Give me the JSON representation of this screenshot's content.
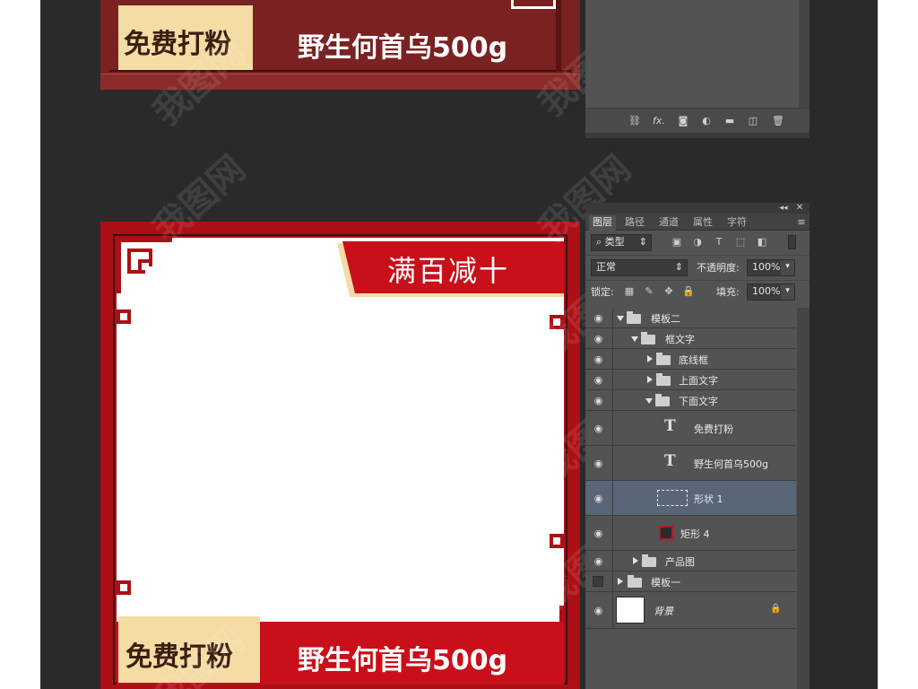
{
  "canvas": {
    "top_product": {
      "tag": "免费打粉",
      "title": "野生何首乌500g"
    },
    "bottom_product": {
      "banner": "满百减十",
      "tag": "免费打粉",
      "title": "野生何首乌500g"
    }
  },
  "top_layers_footer": {
    "icons": [
      "link-icon",
      "fx-icon",
      "mask-icon",
      "adjustment-icon",
      "folder-icon",
      "new-layer-icon",
      "trash-icon"
    ],
    "fx_label": "fx."
  },
  "layers_panel": {
    "tabs": [
      "图层",
      "路径",
      "通道",
      "属性",
      "字符"
    ],
    "filter_label": "类型",
    "blend_mode": "正常",
    "opacity_label": "不透明度:",
    "opacity_value": "100%",
    "lock_label": "锁定:",
    "fill_label": "填充:",
    "fill_value": "100%",
    "layers": [
      {
        "name": "模板二",
        "kind": "group",
        "expanded": true,
        "visible": true
      },
      {
        "name": "框文字",
        "kind": "group",
        "expanded": true,
        "visible": true
      },
      {
        "name": "底线框",
        "kind": "group",
        "expanded": false,
        "visible": true
      },
      {
        "name": "上面文字",
        "kind": "group",
        "expanded": false,
        "visible": true
      },
      {
        "name": "下面文字",
        "kind": "group",
        "expanded": true,
        "visible": true
      },
      {
        "name": "免费打粉",
        "kind": "text",
        "visible": true
      },
      {
        "name": "野生何首乌500g",
        "kind": "text",
        "visible": true
      },
      {
        "name": "形状 1",
        "kind": "shape",
        "visible": true,
        "selected": true
      },
      {
        "name": "矩形 4",
        "kind": "rect",
        "visible": true
      },
      {
        "name": "产品图",
        "kind": "group",
        "expanded": false,
        "visible": true
      },
      {
        "name": "模板一",
        "kind": "group",
        "expanded": false,
        "visible": false
      },
      {
        "name": "背景",
        "kind": "background",
        "visible": true,
        "locked": true
      }
    ]
  },
  "watermark": "我图网",
  "colors": {
    "accent_red": "#c90f1a",
    "dark_red": "#7a2121",
    "tag_cream": "#f4dca4",
    "panel_bg": "#535353",
    "selected_row": "#596678"
  }
}
